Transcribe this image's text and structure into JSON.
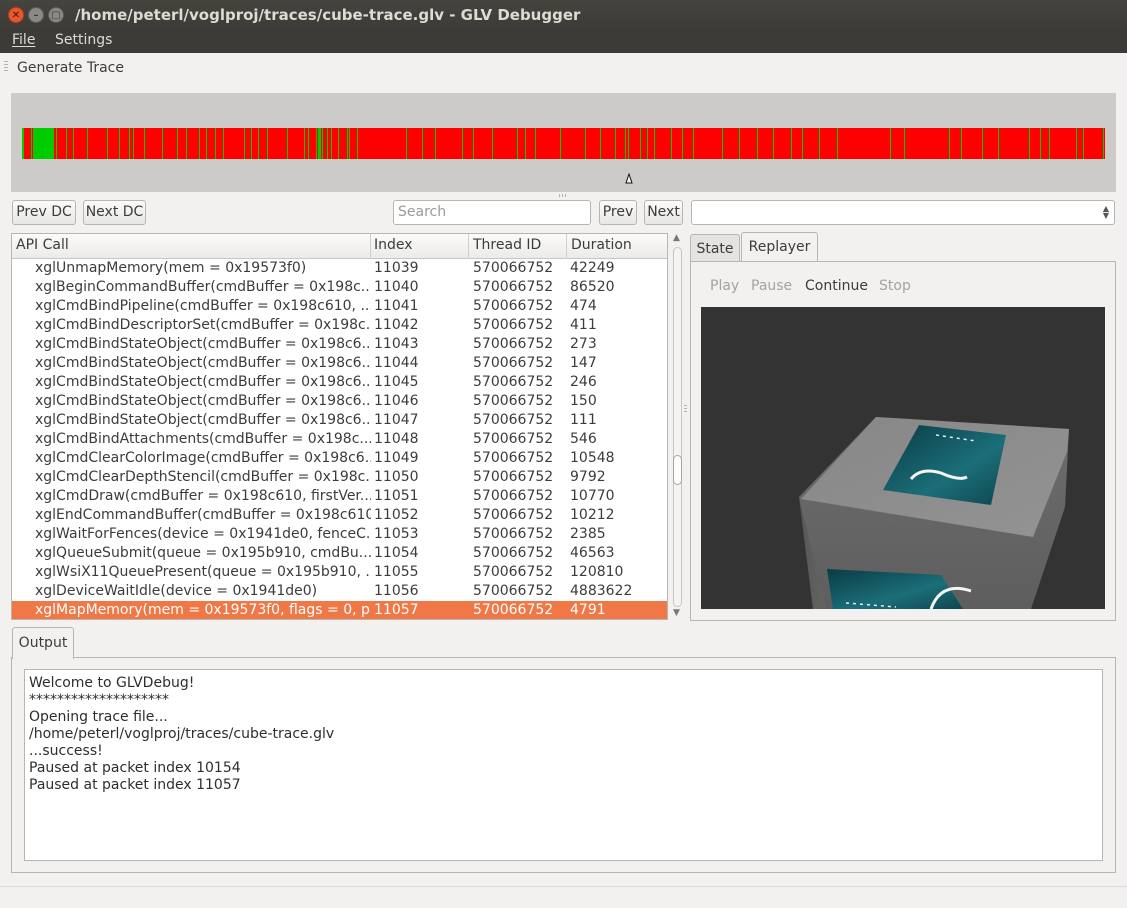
{
  "window": {
    "title": "/home/peterl/voglproj/traces/cube-trace.glv - GLV Debugger"
  },
  "menu": {
    "file": "File",
    "settings": "Settings"
  },
  "toolbar": {
    "generate_trace": "Generate Trace"
  },
  "colors": {
    "timeline_bg": "#ff0000",
    "timeline_marks": "#00cc00",
    "selection": "#f07746"
  },
  "nav": {
    "prev_dc": "Prev DC",
    "next_dc": "Next DC",
    "search_placeholder": "Search",
    "prev": "Prev",
    "next": "Next"
  },
  "table": {
    "headers": [
      "API Call",
      "Index",
      "Thread ID",
      "Duration"
    ],
    "rows": [
      {
        "call": "xglUnmapMemory(mem = 0x19573f0)",
        "index": "11039",
        "thread": "570066752",
        "duration": "42249"
      },
      {
        "call": "xglBeginCommandBuffer(cmdBuffer = 0x198c...",
        "index": "11040",
        "thread": "570066752",
        "duration": "86520"
      },
      {
        "call": "xglCmdBindPipeline(cmdBuffer = 0x198c610, ...",
        "index": "11041",
        "thread": "570066752",
        "duration": "474"
      },
      {
        "call": "xglCmdBindDescriptorSet(cmdBuffer = 0x198c...",
        "index": "11042",
        "thread": "570066752",
        "duration": "411"
      },
      {
        "call": "xglCmdBindStateObject(cmdBuffer = 0x198c6...",
        "index": "11043",
        "thread": "570066752",
        "duration": "273"
      },
      {
        "call": "xglCmdBindStateObject(cmdBuffer = 0x198c6...",
        "index": "11044",
        "thread": "570066752",
        "duration": "147"
      },
      {
        "call": "xglCmdBindStateObject(cmdBuffer = 0x198c6...",
        "index": "11045",
        "thread": "570066752",
        "duration": "246"
      },
      {
        "call": "xglCmdBindStateObject(cmdBuffer = 0x198c6...",
        "index": "11046",
        "thread": "570066752",
        "duration": "150"
      },
      {
        "call": "xglCmdBindStateObject(cmdBuffer = 0x198c6...",
        "index": "11047",
        "thread": "570066752",
        "duration": "111"
      },
      {
        "call": "xglCmdBindAttachments(cmdBuffer = 0x198c...",
        "index": "11048",
        "thread": "570066752",
        "duration": "546"
      },
      {
        "call": "xglCmdClearColorImage(cmdBuffer = 0x198c6...",
        "index": "11049",
        "thread": "570066752",
        "duration": "10548"
      },
      {
        "call": "xglCmdClearDepthStencil(cmdBuffer = 0x198c...",
        "index": "11050",
        "thread": "570066752",
        "duration": "9792"
      },
      {
        "call": "xglCmdDraw(cmdBuffer = 0x198c610, firstVer...",
        "index": "11051",
        "thread": "570066752",
        "duration": "10770"
      },
      {
        "call": "xglEndCommandBuffer(cmdBuffer = 0x198c610)",
        "index": "11052",
        "thread": "570066752",
        "duration": "10212"
      },
      {
        "call": "xglWaitForFences(device = 0x1941de0, fenceC...",
        "index": "11053",
        "thread": "570066752",
        "duration": "2385"
      },
      {
        "call": "xglQueueSubmit(queue = 0x195b910, cmdBu...",
        "index": "11054",
        "thread": "570066752",
        "duration": "46563"
      },
      {
        "call": "xglWsiX11QueuePresent(queue = 0x195b910, ...",
        "index": "11055",
        "thread": "570066752",
        "duration": "120810"
      },
      {
        "call": "xglDeviceWaitIdle(device = 0x1941de0)",
        "index": "11056",
        "thread": "570066752",
        "duration": "4883622"
      },
      {
        "call": "xglMapMemory(mem = 0x19573f0, flags = 0, p...",
        "index": "11057",
        "thread": "570066752",
        "duration": "4791"
      }
    ]
  },
  "right_tabs": {
    "state": "State",
    "replayer": "Replayer"
  },
  "replayer": {
    "play": "Play",
    "pause": "Pause",
    "continue": "Continue",
    "stop": "Stop"
  },
  "output": {
    "tab": "Output",
    "lines": [
      "Welcome to GLVDebug!",
      "********************",
      "Opening trace file...",
      "/home/peterl/voglproj/traces/cube-trace.glv",
      "...success!",
      "Paused at packet index 10154",
      "Paused at packet index 11057"
    ]
  }
}
